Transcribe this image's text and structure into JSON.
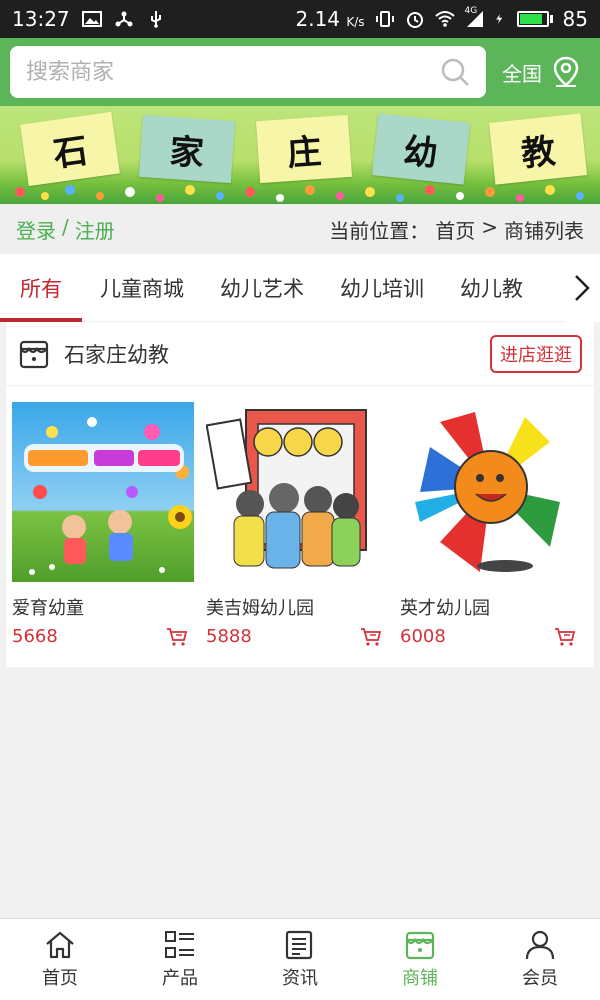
{
  "status_bar": {
    "time": "13:27",
    "speed": "2.14",
    "speed_unit": "K/s",
    "network": "4G",
    "battery": "85",
    "battery_level": 0.85
  },
  "search": {
    "placeholder": "搜索商家",
    "region_label": "全国"
  },
  "banner": {
    "chars": [
      "石",
      "家",
      "庄",
      "幼",
      "教"
    ]
  },
  "crumb": {
    "login": "登录",
    "sep": "/",
    "register": "注册",
    "position_label": "当前位置：",
    "home": "首页",
    "arrow": ">",
    "current": "商铺列表"
  },
  "tabs": [
    {
      "label": "所有",
      "active": true
    },
    {
      "label": "儿童商城"
    },
    {
      "label": "幼儿艺术"
    },
    {
      "label": "幼儿培训"
    },
    {
      "label": "幼儿教"
    }
  ],
  "shop": {
    "name": "石家庄幼教",
    "visit_label": "进店逛逛",
    "products": [
      {
        "name": "爱育幼童",
        "price": "5668"
      },
      {
        "name": "美吉姆幼儿园",
        "price": "5888"
      },
      {
        "name": "英才幼儿园",
        "price": "6008"
      }
    ]
  },
  "bottom_nav": [
    {
      "label": "首页",
      "icon": "home-icon"
    },
    {
      "label": "产品",
      "icon": "grid-list-icon"
    },
    {
      "label": "资讯",
      "icon": "news-icon"
    },
    {
      "label": "商铺",
      "icon": "store-icon",
      "active": true
    },
    {
      "label": "会员",
      "icon": "user-icon"
    }
  ],
  "colors": {
    "brand_green": "#5db55a",
    "accent_red": "#d3323a",
    "tab_active": "#c0262d"
  }
}
